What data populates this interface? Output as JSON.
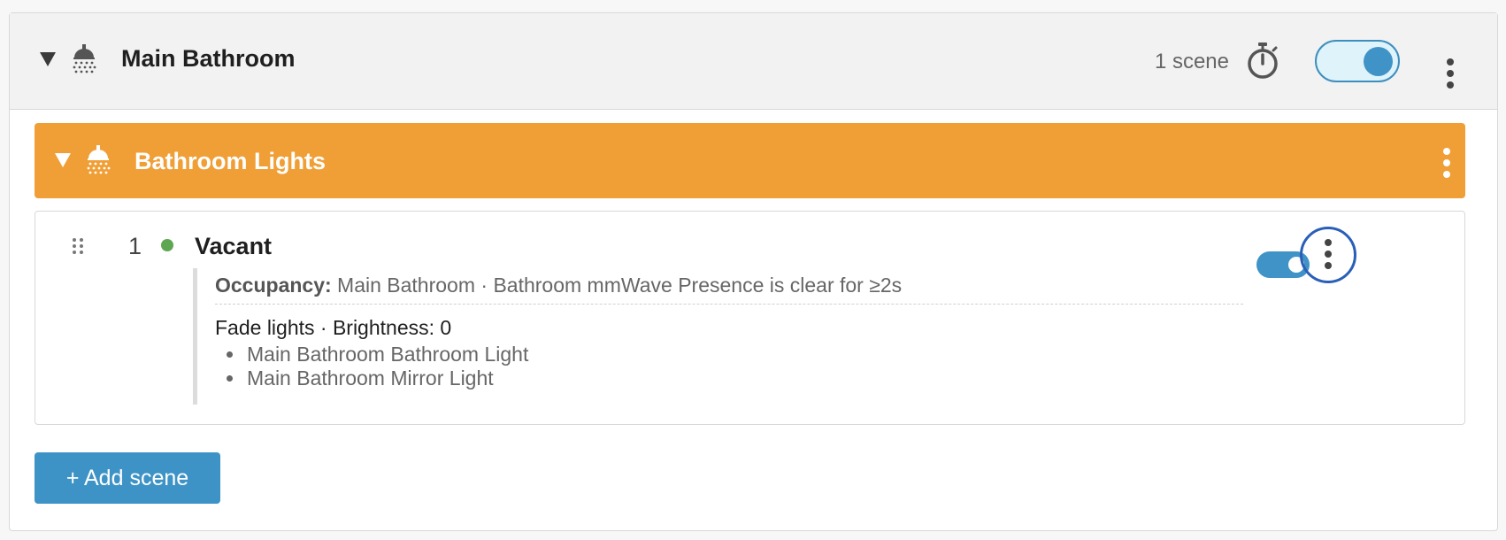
{
  "room": {
    "title": "Main Bathroom",
    "scene_count": "1 scene",
    "icon": "shower-icon",
    "enabled": true
  },
  "group": {
    "title": "Bathroom Lights",
    "icon": "shower-icon",
    "color": "#f09f37"
  },
  "scene": {
    "index": "1",
    "name": "Vacant",
    "status_color": "#5fa652",
    "condition_label": "Occupancy:",
    "condition_text": "Main Bathroom · Bathroom mmWave Presence is clear for ≥2s",
    "action_text": "Fade lights · Brightness: 0",
    "targets": [
      "Main Bathroom Bathroom Light",
      "Main Bathroom Mirror Light"
    ],
    "enabled": true
  },
  "add_scene_label": "+ Add scene",
  "colors": {
    "accent": "#3e93c6",
    "focus_ring": "#2a5fb8"
  }
}
